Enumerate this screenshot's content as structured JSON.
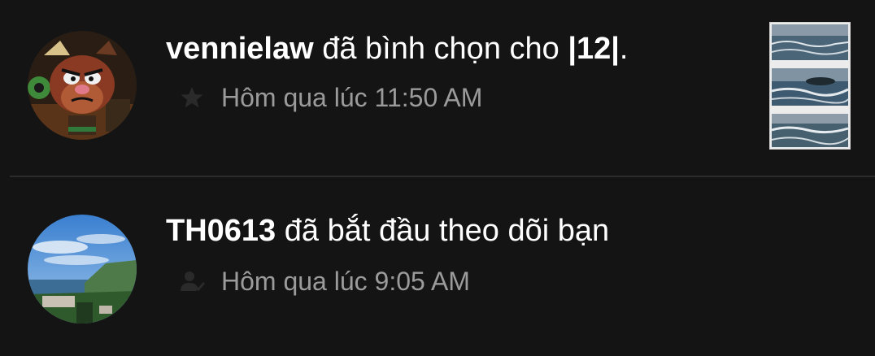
{
  "notifications": [
    {
      "username": "vennielaw",
      "action": "đã bình chọn cho",
      "target": "|12|",
      "target_suffix": ".",
      "time": "Hôm qua lúc 11:50 AM",
      "type_icon": "star-icon",
      "has_thumbnail": true
    },
    {
      "username": "TH0613",
      "action": "đã bắt đầu theo dõi bạn",
      "time": "Hôm qua lúc 9:05 AM",
      "type_icon": "follow-user-icon",
      "has_thumbnail": false
    }
  ],
  "colors": {
    "background": "#141414",
    "primary_text": "#ffffff",
    "secondary_text": "#9b9b9b",
    "icon": "#2a2a2a",
    "divider": "#2b2b2b"
  }
}
